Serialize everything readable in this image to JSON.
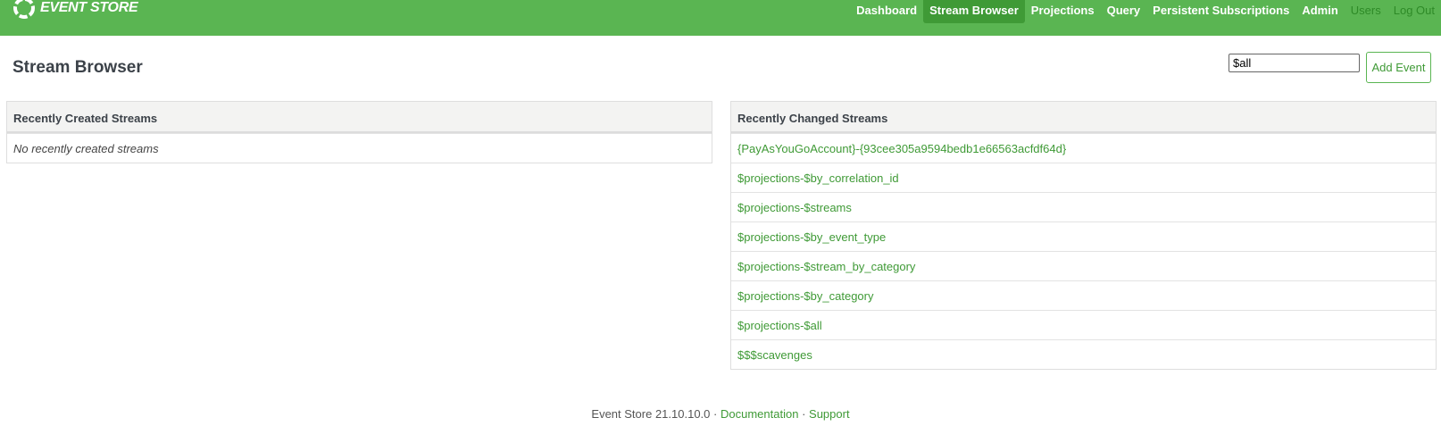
{
  "brand": {
    "name": "EVENT STORE",
    "accent_color": "#5ab552",
    "active_color": "#3f9a36"
  },
  "nav": {
    "items": [
      {
        "label": "Dashboard",
        "active": false
      },
      {
        "label": "Stream Browser",
        "active": true
      },
      {
        "label": "Projections",
        "active": false
      },
      {
        "label": "Query",
        "active": false
      },
      {
        "label": "Persistent Subscriptions",
        "active": false
      },
      {
        "label": "Admin",
        "active": false
      },
      {
        "label": "Users",
        "active": false
      },
      {
        "label": "Log Out",
        "active": false
      }
    ]
  },
  "page": {
    "title": "Stream Browser"
  },
  "search": {
    "value": "$all"
  },
  "add_event": {
    "label": "Add Event"
  },
  "recently_created": {
    "heading": "Recently Created Streams",
    "empty_text": "No recently created streams"
  },
  "recently_changed": {
    "heading": "Recently Changed Streams",
    "streams": [
      "{PayAsYouGoAccount}-{93cee305a9594bedb1e66563acfdf64d}",
      "$projections-$by_correlation_id",
      "$projections-$streams",
      "$projections-$by_event_type",
      "$projections-$stream_by_category",
      "$projections-$by_category",
      "$projections-$all",
      "$$$scavenges"
    ]
  },
  "footer": {
    "version_text": "Event Store 21.10.10.0",
    "separator": "·",
    "documentation_label": "Documentation",
    "support_label": "Support"
  }
}
